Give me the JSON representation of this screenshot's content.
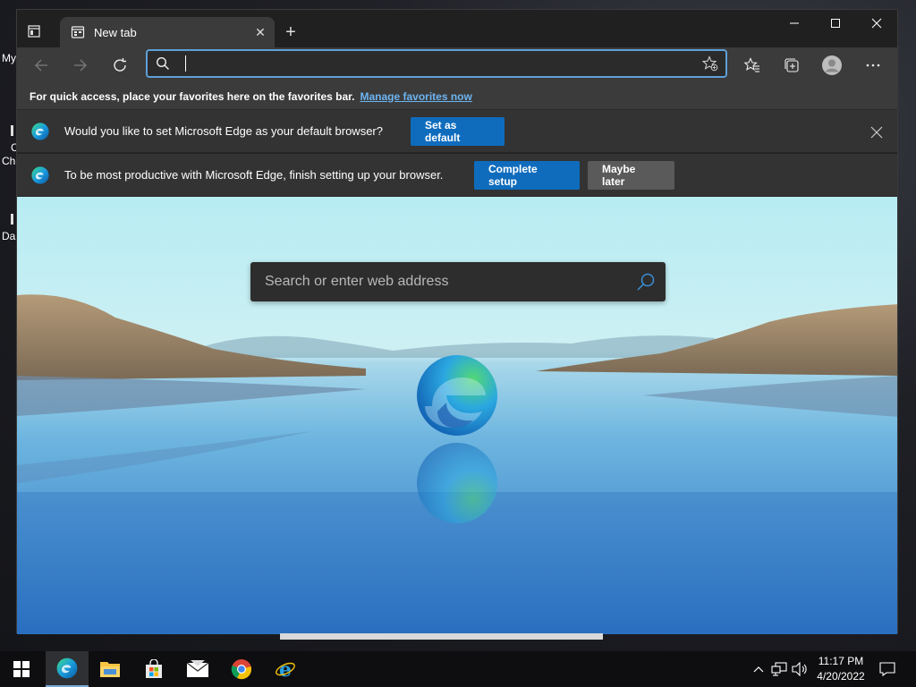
{
  "desktop": {
    "icon_labels": [
      "My",
      "C",
      "Ch",
      "Da"
    ]
  },
  "browser": {
    "tab": {
      "title": "New tab",
      "close": "✕"
    },
    "new_tab": "+",
    "window_controls": {
      "minimize": "—",
      "maximize": "☐",
      "close": "✕"
    },
    "address_bar": {
      "value": "",
      "placeholder": ""
    },
    "favorites_bar": {
      "message": "For quick access, place your favorites here on the favorites bar.",
      "link": "Manage favorites now"
    },
    "default_prompt": {
      "message": "Would you like to set Microsoft Edge as your default browser?",
      "button": "Set as default",
      "close": "✕"
    },
    "setup_prompt": {
      "message": "To be most productive with Microsoft Edge, finish setting up your browser.",
      "primary_button": "Complete setup",
      "secondary_button": "Maybe later"
    },
    "ntp": {
      "search_placeholder": "Search or enter web address"
    }
  },
  "taskbar": {
    "apps": [
      "start-icon",
      "edge-icon",
      "file-explorer-icon",
      "store-icon",
      "mail-icon",
      "chrome-icon",
      "internet-explorer-icon"
    ],
    "clock": {
      "time": "11:17 PM",
      "date": "4/20/2022"
    }
  },
  "colors": {
    "accent": "#0f6cbd",
    "link": "#6cb4f0",
    "address_border": "#5ea0d8"
  }
}
